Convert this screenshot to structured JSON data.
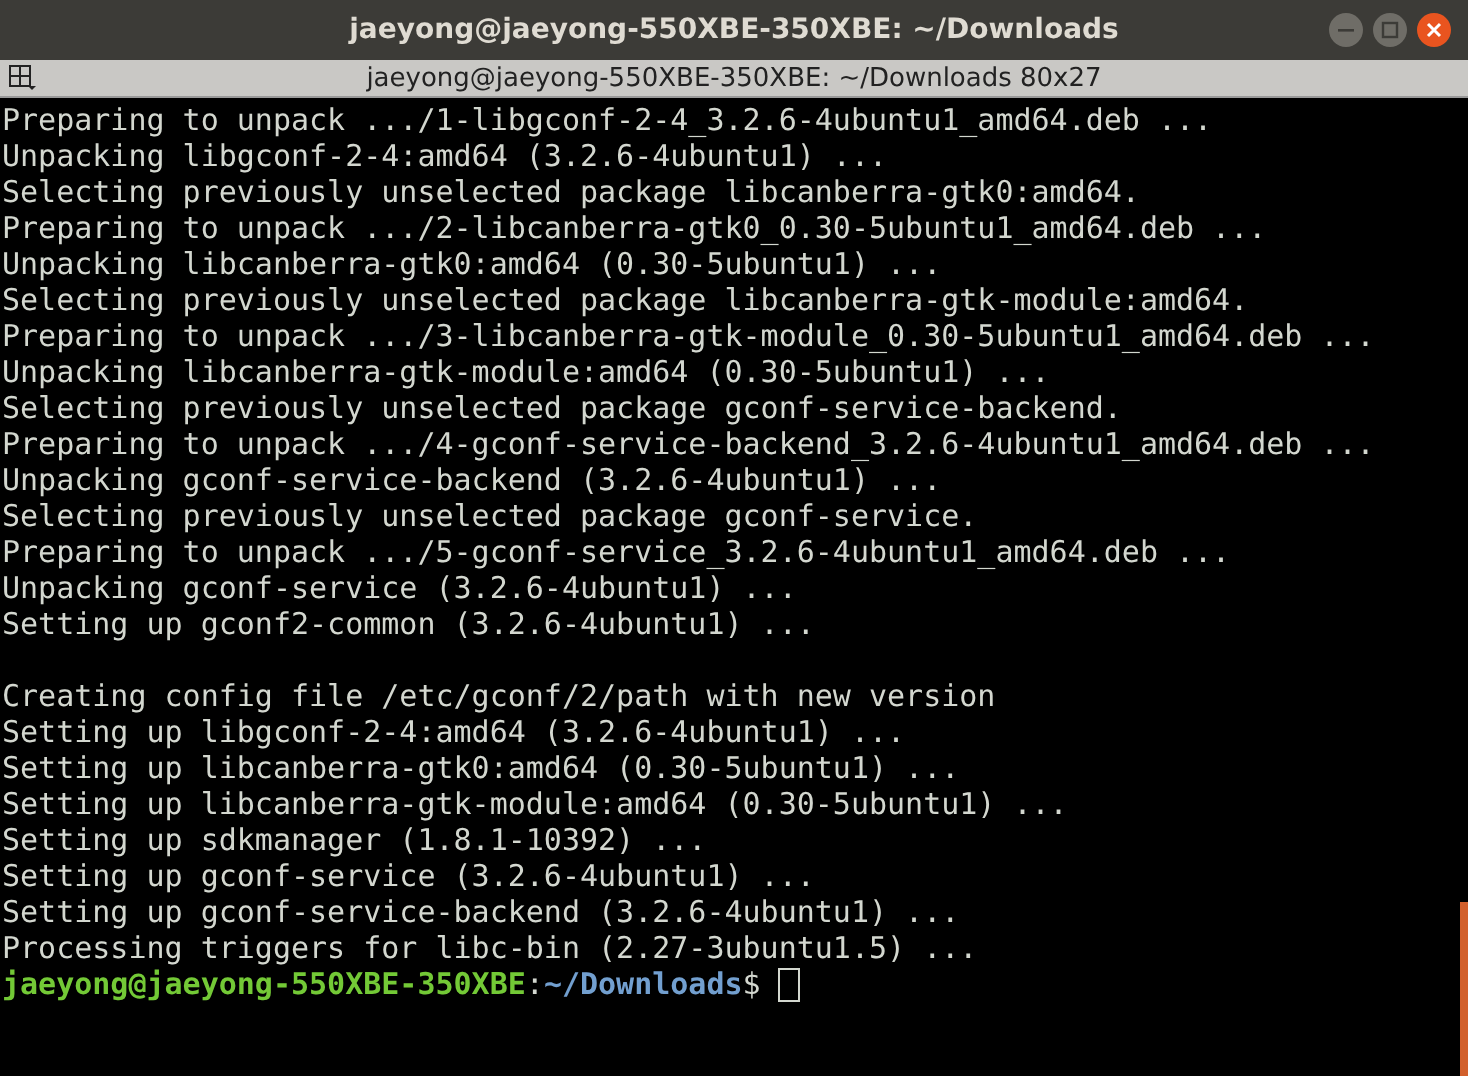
{
  "window": {
    "title": "jaeyong@jaeyong-550XBE-350XBE: ~/Downloads"
  },
  "tab_bar": {
    "title": "jaeyong@jaeyong-550XBE-350XBE: ~/Downloads 80x27"
  },
  "lines": [
    {
      "kind": "output",
      "text": "Preparing to unpack .../1-libgconf-2-4_3.2.6-4ubuntu1_amd64.deb ..."
    },
    {
      "kind": "output",
      "text": "Unpacking libgconf-2-4:amd64 (3.2.6-4ubuntu1) ..."
    },
    {
      "kind": "output",
      "text": "Selecting previously unselected package libcanberra-gtk0:amd64."
    },
    {
      "kind": "output",
      "text": "Preparing to unpack .../2-libcanberra-gtk0_0.30-5ubuntu1_amd64.deb ..."
    },
    {
      "kind": "output",
      "text": "Unpacking libcanberra-gtk0:amd64 (0.30-5ubuntu1) ..."
    },
    {
      "kind": "output",
      "text": "Selecting previously unselected package libcanberra-gtk-module:amd64."
    },
    {
      "kind": "output",
      "text": "Preparing to unpack .../3-libcanberra-gtk-module_0.30-5ubuntu1_amd64.deb ..."
    },
    {
      "kind": "output",
      "text": "Unpacking libcanberra-gtk-module:amd64 (0.30-5ubuntu1) ..."
    },
    {
      "kind": "output",
      "text": "Selecting previously unselected package gconf-service-backend."
    },
    {
      "kind": "output",
      "text": "Preparing to unpack .../4-gconf-service-backend_3.2.6-4ubuntu1_amd64.deb ..."
    },
    {
      "kind": "output",
      "text": "Unpacking gconf-service-backend (3.2.6-4ubuntu1) ..."
    },
    {
      "kind": "output",
      "text": "Selecting previously unselected package gconf-service."
    },
    {
      "kind": "output",
      "text": "Preparing to unpack .../5-gconf-service_3.2.6-4ubuntu1_amd64.deb ..."
    },
    {
      "kind": "output",
      "text": "Unpacking gconf-service (3.2.6-4ubuntu1) ..."
    },
    {
      "kind": "output",
      "text": "Setting up gconf2-common (3.2.6-4ubuntu1) ..."
    },
    {
      "kind": "blank"
    },
    {
      "kind": "output",
      "text": "Creating config file /etc/gconf/2/path with new version"
    },
    {
      "kind": "output",
      "text": "Setting up libgconf-2-4:amd64 (3.2.6-4ubuntu1) ..."
    },
    {
      "kind": "output",
      "text": "Setting up libcanberra-gtk0:amd64 (0.30-5ubuntu1) ..."
    },
    {
      "kind": "output",
      "text": "Setting up libcanberra-gtk-module:amd64 (0.30-5ubuntu1) ..."
    },
    {
      "kind": "output",
      "text": "Setting up sdkmanager (1.8.1-10392) ..."
    },
    {
      "kind": "output",
      "text": "Setting up gconf-service (3.2.6-4ubuntu1) ..."
    },
    {
      "kind": "output",
      "text": "Setting up gconf-service-backend (3.2.6-4ubuntu1) ..."
    },
    {
      "kind": "output",
      "text": "Processing triggers for libc-bin (2.27-3ubuntu1.5) ..."
    }
  ],
  "prompt": {
    "user_host": "jaeyong@jaeyong-550XBE-350XBE",
    "separator": ":",
    "path": "~/Downloads",
    "symbol": "$"
  }
}
